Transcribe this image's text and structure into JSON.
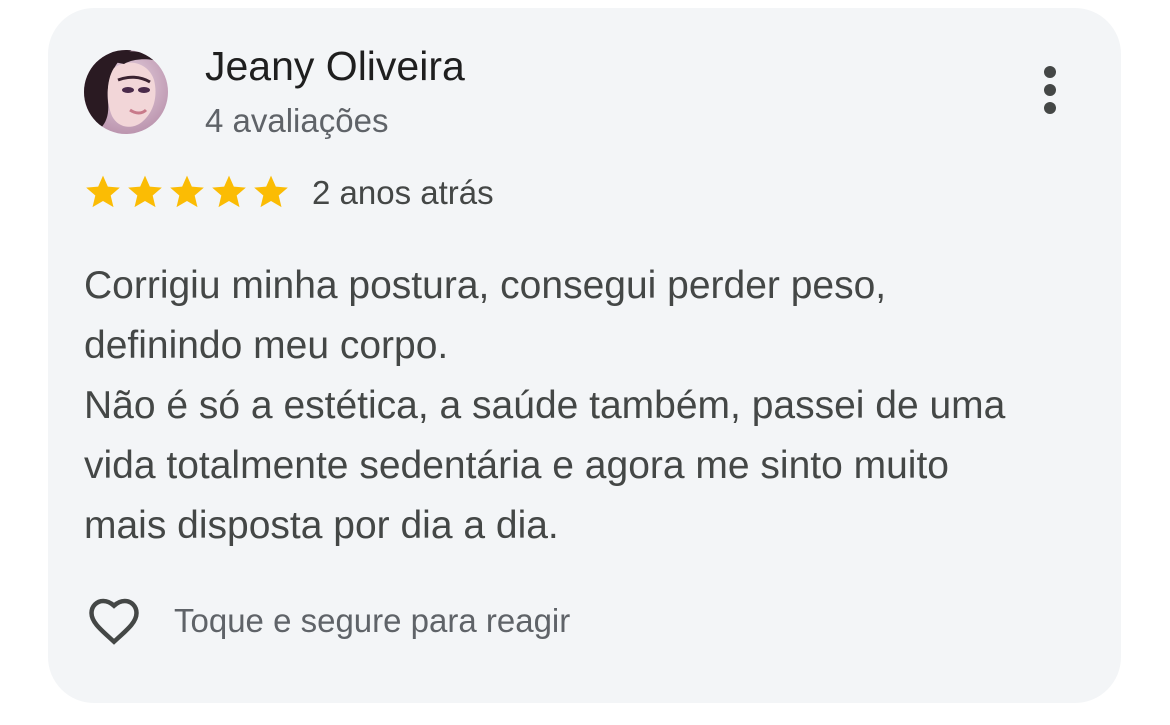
{
  "review": {
    "reviewer_name": "Jeany Oliveira",
    "review_count": "4 avaliações",
    "rating": 5,
    "rating_max": 5,
    "date": "2 anos atrás",
    "text_lines": [
      "Corrigiu minha postura, consegui perder peso,",
      "definindo meu corpo.",
      "Não é só a estética, a saúde também, passei de uma",
      "vida totalmente sedentária e agora me sinto muito",
      "mais disposta por dia a dia."
    ],
    "react_label": "Toque e segure para reagir"
  },
  "icons": {
    "avatar": "profile-photo",
    "more": "more-vert-icon",
    "star": "star-icon",
    "heart": "heart-outline-icon"
  },
  "colors": {
    "card_background": "#f3f5f7",
    "star": "#fbbc04",
    "name": "#1f1f1f",
    "secondary_text": "#5f6368",
    "body_text": "#444746"
  }
}
